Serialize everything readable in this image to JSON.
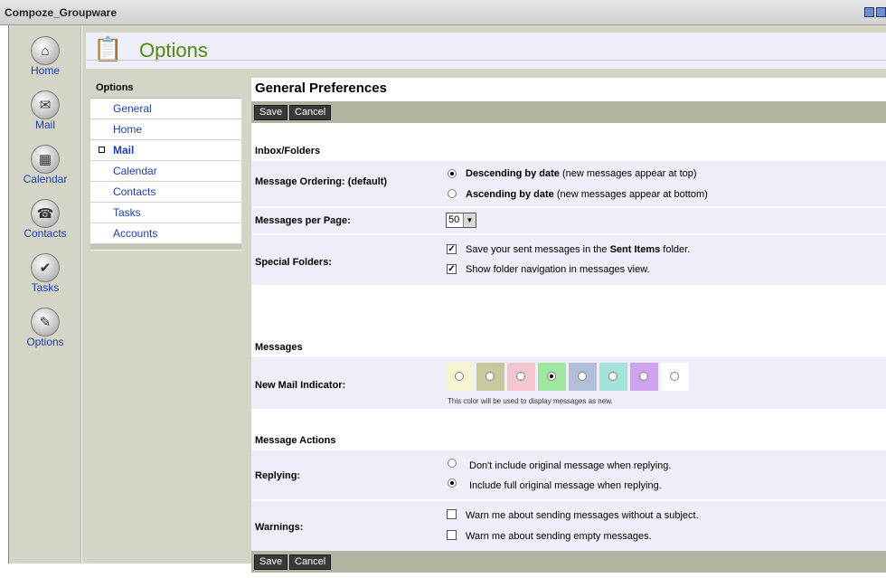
{
  "app": {
    "title": "Compoze_Groupware"
  },
  "nav": [
    {
      "label": "Home",
      "icon": "home-icon",
      "glyph": "⌂"
    },
    {
      "label": "Mail",
      "icon": "mail-icon",
      "glyph": "✉"
    },
    {
      "label": "Calendar",
      "icon": "calendar-icon",
      "glyph": "▦"
    },
    {
      "label": "Contacts",
      "icon": "contacts-icon",
      "glyph": "☎"
    },
    {
      "label": "Tasks",
      "icon": "tasks-icon",
      "glyph": "✔"
    },
    {
      "label": "Options",
      "icon": "options-icon",
      "glyph": "✎"
    }
  ],
  "header": {
    "title": "Options",
    "icon": "options-icon",
    "glyph": "📋"
  },
  "subnav": {
    "heading": "Options",
    "items": [
      {
        "label": "General",
        "active": false
      },
      {
        "label": "Home",
        "active": false
      },
      {
        "label": "Mail",
        "active": true
      },
      {
        "label": "Calendar",
        "active": false
      },
      {
        "label": "Contacts",
        "active": false
      },
      {
        "label": "Tasks",
        "active": false
      },
      {
        "label": "Accounts",
        "active": false
      }
    ]
  },
  "page": {
    "title": "General Preferences"
  },
  "buttons": {
    "save": "Save",
    "cancel": "Cancel"
  },
  "sections": {
    "inbox": "Inbox/Folders",
    "messages": "Messages",
    "actions": "Message Actions"
  },
  "ordering": {
    "label": "Message Ordering: (default)",
    "opt1_bold": "Descending by date",
    "opt1_rest": " (new messages appear at top)",
    "opt2_bold": "Ascending by date",
    "opt2_rest": " (new messages appear at bottom)",
    "selected": 0
  },
  "per_page": {
    "label": "Messages per Page:",
    "value": "50"
  },
  "special": {
    "label": "Special Folders:",
    "opt1_a": "Save your sent messages in the ",
    "opt1_b": "Sent Items",
    "opt1_c": " folder.",
    "opt2": "Show folder navigation in messages view.",
    "checked": [
      true,
      true
    ]
  },
  "indicator": {
    "label": "New Mail Indicator:",
    "colors": [
      "#f5f3d0",
      "#c7c99c",
      "#f5c6cf",
      "#9fe6a0",
      "#b3bfd8",
      "#a6e2dc",
      "#cfa3f0",
      "#ffffff"
    ],
    "selected": 3,
    "hint": "This color will be used to display messages as new."
  },
  "replying": {
    "label": "Replying:",
    "opt1": "Don't include original message when replying.",
    "opt2": "Include full original message when replying.",
    "selected": 1
  },
  "warnings": {
    "label": "Warnings:",
    "opt1": "Warn me about sending messages without a subject.",
    "opt2": "Warn me about sending empty messages.",
    "checked": [
      false,
      false
    ]
  }
}
